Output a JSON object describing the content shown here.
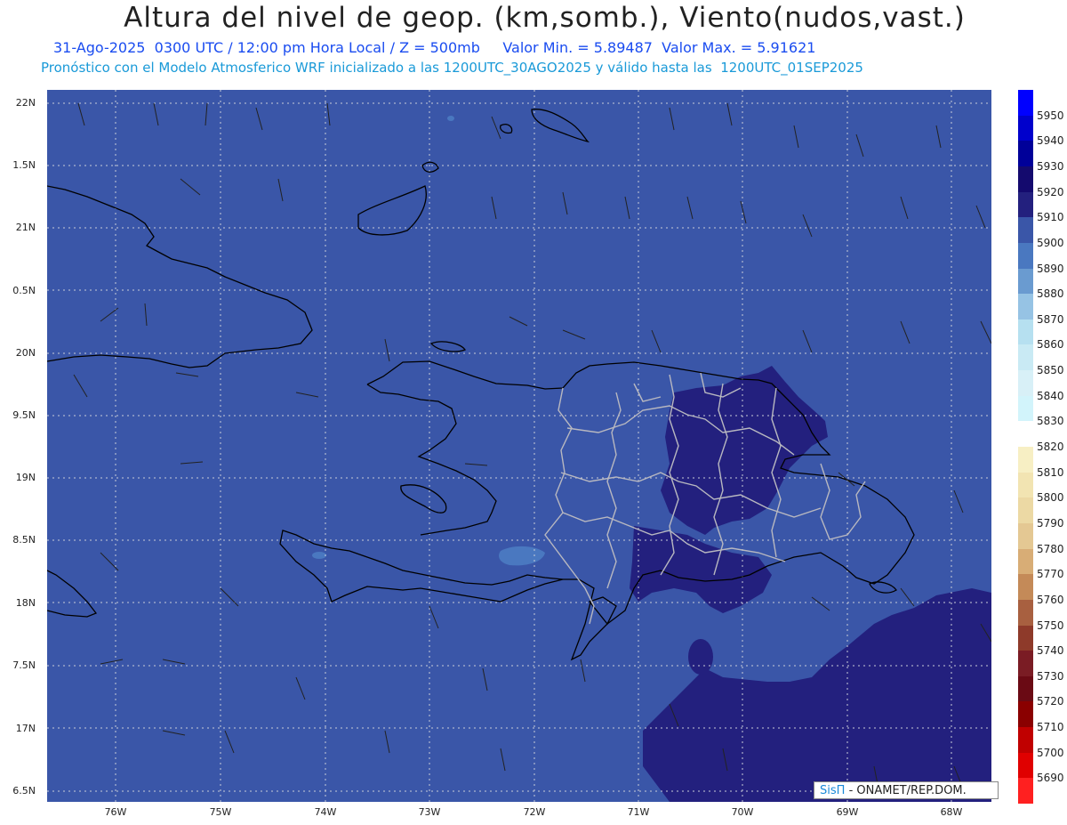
{
  "header": {
    "title": "Altura del nivel de geop. (km,somb.), Viento(nudos,vast.)",
    "subtitle1": "31-Ago-2025  0300 UTC / 12:00 pm Hora Local / Z = 500mb     Valor Min. = 5.89487  Valor Max. = 5.91621",
    "subtitle2": "Pronóstico con el Modelo Atmosferico WRF inicializado a las 1200UTC_30AGO2025 y válido hasta las  1200UTC_01SEP2025"
  },
  "axes": {
    "y_labels": [
      "22N",
      "1.5N",
      "21N",
      "0.5N",
      "20N",
      "9.5N",
      "19N",
      "8.5N",
      "18N",
      "7.5N",
      "17N",
      "6.5N"
    ],
    "x_labels": [
      "76W",
      "75W",
      "74W",
      "73W",
      "72W",
      "71W",
      "70W",
      "69W",
      "68W"
    ]
  },
  "colorbar": {
    "levels": [
      "5950",
      "5940",
      "5930",
      "5920",
      "5910",
      "5900",
      "5890",
      "5880",
      "5870",
      "5860",
      "5850",
      "5840",
      "5830",
      "5820",
      "5810",
      "5800",
      "5790",
      "5780",
      "5770",
      "5760",
      "5750",
      "5740",
      "5730",
      "5720",
      "5710",
      "5700",
      "5690"
    ],
    "colors": [
      "#0000ff",
      "#0000cc",
      "#000099",
      "#140a6e",
      "#23207e",
      "#3a56a8",
      "#4a78c0",
      "#6a9bd0",
      "#96c3e4",
      "#b6e0f0",
      "#c9eaf4",
      "#d8f0f7",
      "#d2f4fb",
      "#ffffff",
      "#f7efc4",
      "#f2e4b2",
      "#ecd9a4",
      "#e4c893",
      "#d8ad76",
      "#c48a58",
      "#a86040",
      "#8e3a2a",
      "#7a1c24",
      "#6a0a14",
      "#8a0000",
      "#c00000",
      "#e00000",
      "#ff2020"
    ]
  },
  "credit": {
    "sis": "SisΠ",
    "text": "- ONAMET/REP.DOM."
  }
}
